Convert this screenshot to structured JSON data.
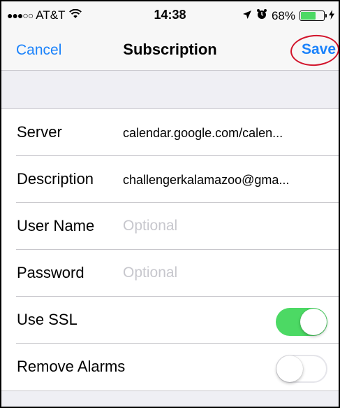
{
  "status_bar": {
    "signal": "●●●○○",
    "carrier": "AT&T",
    "time": "14:38",
    "battery_percent": "68%",
    "battery_level": 0.68
  },
  "nav": {
    "cancel_label": "Cancel",
    "title": "Subscription",
    "save_label": "Save"
  },
  "rows": [
    {
      "label": "Server",
      "value": "calendar.google.com/calen..."
    },
    {
      "label": "Description",
      "value": "challengerkalamazoo@gma..."
    },
    {
      "label": "User Name",
      "placeholder": "Optional"
    },
    {
      "label": "Password",
      "placeholder": "Optional"
    },
    {
      "label": "Use SSL",
      "toggle": true
    },
    {
      "label": "Remove Alarms",
      "toggle": false
    }
  ],
  "colors": {
    "accent": "#1a82fb",
    "toggle_on": "#4cd964",
    "annotation_circle": "#d2142b"
  }
}
